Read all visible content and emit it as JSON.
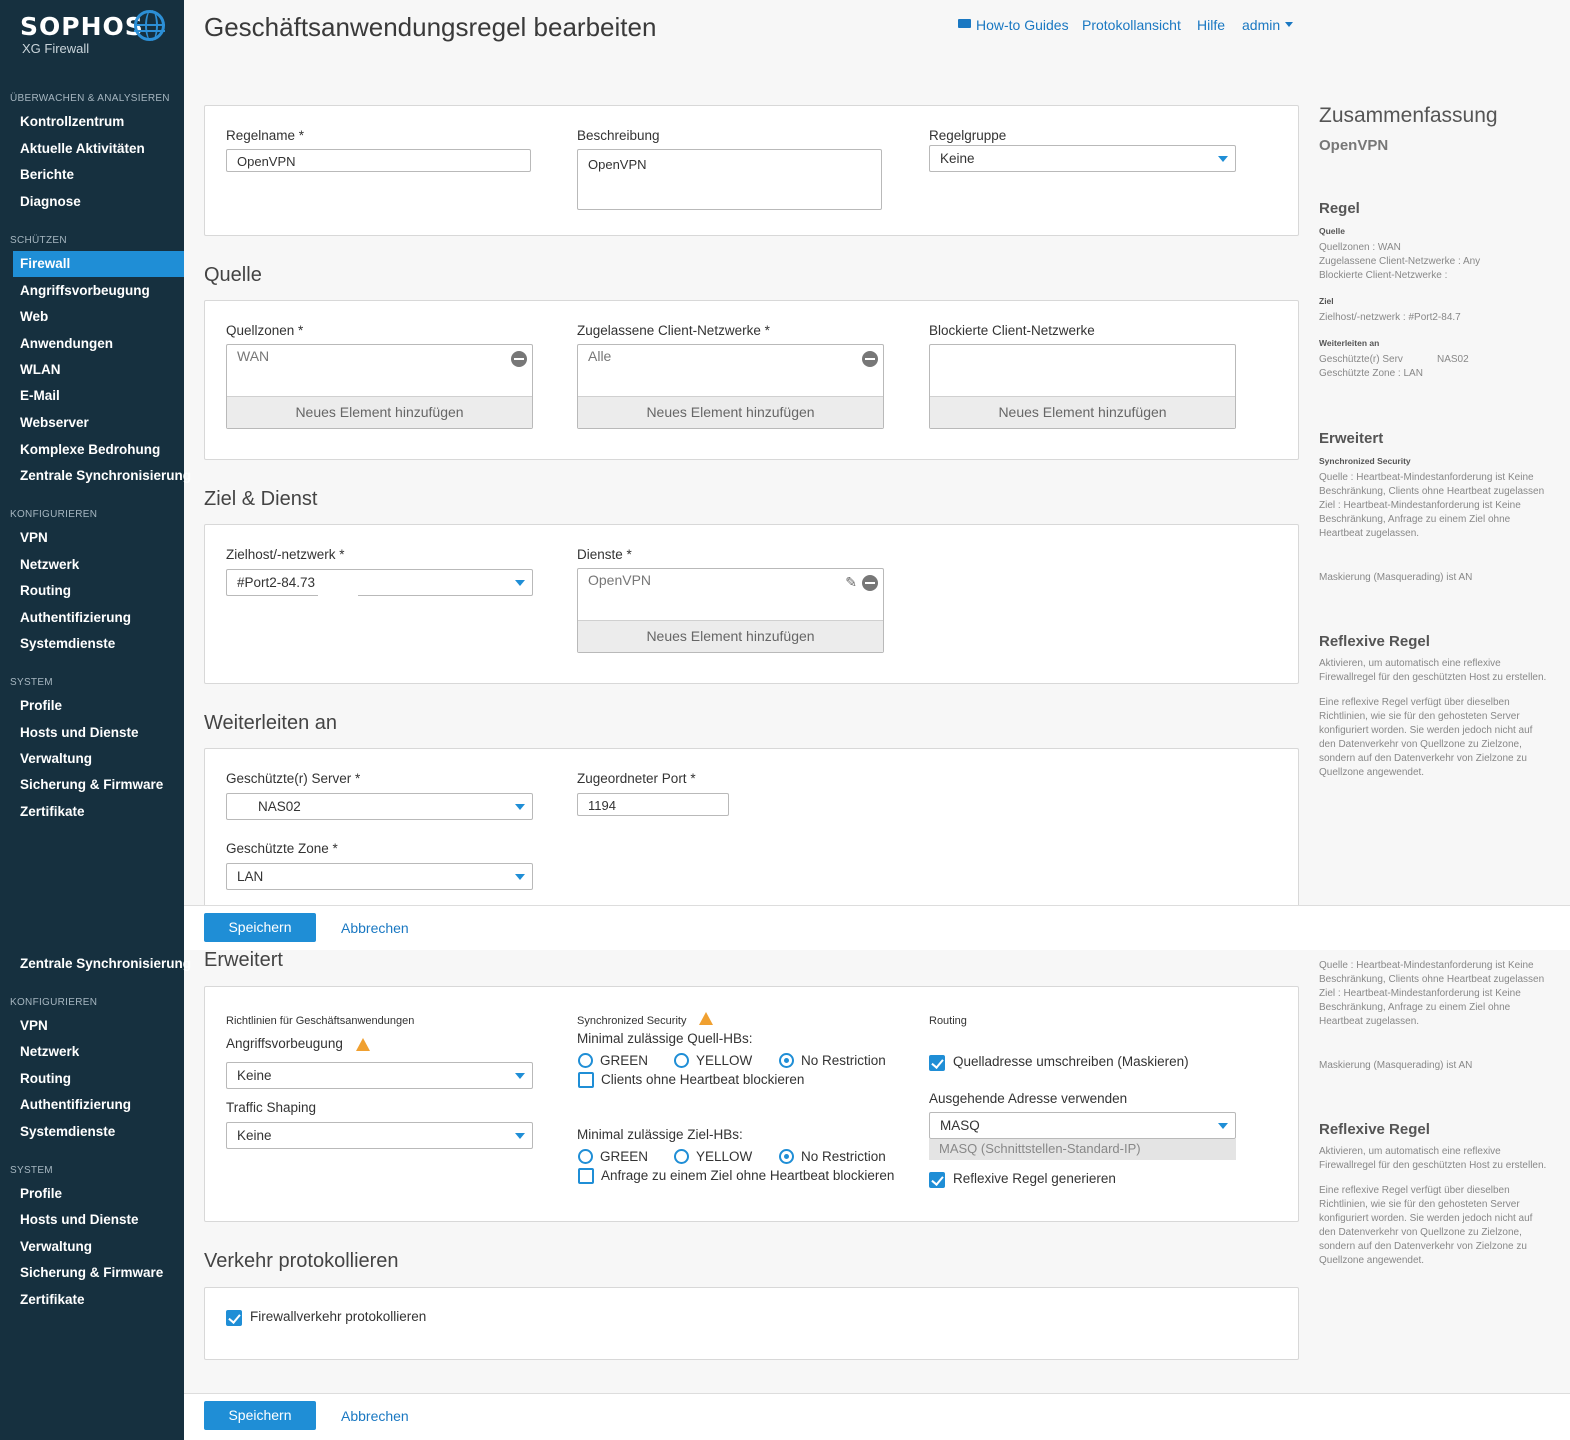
{
  "brand": {
    "name": "SOPHOS",
    "product": "XG Firewall"
  },
  "sidebar": {
    "sections": [
      {
        "title": "ÜBERWACHEN & ANALYSIEREN",
        "items": [
          "Kontrollzentrum",
          "Aktuelle Aktivitäten",
          "Berichte",
          "Diagnose"
        ]
      },
      {
        "title": "SCHÜTZEN",
        "items": [
          "Firewall",
          "Angriffsvorbeugung",
          "Web",
          "Anwendungen",
          "WLAN",
          "E-Mail",
          "Webserver",
          "Komplexe Bedrohung",
          "Zentrale Synchronisierung"
        ]
      },
      {
        "title": "KONFIGURIEREN",
        "items": [
          "VPN",
          "Netzwerk",
          "Routing",
          "Authentifizierung",
          "Systemdienste"
        ]
      },
      {
        "title": "SYSTEM",
        "items": [
          "Profile",
          "Hosts und Dienste",
          "Verwaltung",
          "Sicherung & Firmware",
          "Zertifikate"
        ]
      }
    ],
    "active": "Firewall"
  },
  "header": {
    "title": "Geschäftsanwendungsregel bearbeiten",
    "links": {
      "guides": "How-to Guides",
      "log": "Protokollansicht",
      "help": "Hilfe",
      "user": "admin"
    }
  },
  "general": {
    "rule_name_label": "Regelname *",
    "rule_name": "OpenVPN",
    "description_label": "Beschreibung",
    "description": "OpenVPN",
    "group_label": "Regelgruppe",
    "group": "Keine"
  },
  "source": {
    "title": "Quelle",
    "zones_label": "Quellzonen *",
    "zones": "WAN",
    "allowed_label": "Zugelassene Client-Netzwerke *",
    "allowed": "Alle",
    "blocked_label": "Blockierte Client-Netzwerke",
    "add_label": "Neues Element hinzufügen"
  },
  "destination": {
    "title": "Ziel & Dienst",
    "host_label": "Zielhost/-netzwerk *",
    "host": "#Port2-84.73",
    "services_label": "Dienste *",
    "services": "OpenVPN",
    "add_label": "Neues Element hinzufügen"
  },
  "forward": {
    "title": "Weiterleiten an",
    "server_label": "Geschützte(r) Server *",
    "server": "NAS02",
    "port_label": "Zugeordneter Port *",
    "port": "1194",
    "zone_label": "Geschützte Zone *",
    "zone": "LAN"
  },
  "actions": {
    "save": "Speichern",
    "cancel": "Abbrechen"
  },
  "advanced": {
    "title": "Erweitert",
    "policies_label": "Richtlinien für Geschäftsanwendungen",
    "ips_label": "Angriffsvorbeugung",
    "ips": "Keine",
    "shaping_label": "Traffic Shaping",
    "shaping": "Keine",
    "sync_label": "Synchronized Security",
    "min_src_label": "Minimal zulässige Quell-HBs:",
    "min_dst_label": "Minimal zulässige Ziel-HBs:",
    "green": "GREEN",
    "yellow": "YELLOW",
    "norestr": "No Restriction",
    "block_src": "Clients ohne Heartbeat blockieren",
    "block_dst": "Anfrage zu einem Ziel ohne Heartbeat blockieren",
    "routing_label": "Routing",
    "masq_label": "Quelladresse umschreiben (Maskieren)",
    "outgoing_label": "Ausgehende Adresse verwenden",
    "outgoing": "MASQ",
    "outgoing_hint": "MASQ (Schnittstellen-Standard-IP)",
    "reflexive_label": "Reflexive Regel generieren"
  },
  "log": {
    "title": "Verkehr protokollieren",
    "fw_label": "Firewallverkehr protokollieren"
  },
  "summary": {
    "title": "Zusammenfassung",
    "name": "OpenVPN",
    "rule_h": "Regel",
    "source_h": "Quelle",
    "source_lines": [
      "Quellzonen : WAN",
      "Zugelassene Client-Netzwerke : Any",
      "Blockierte Client-Netzwerke :"
    ],
    "dest_h": "Ziel",
    "dest_line": "Zielhost/-netzwerk : #Port2-84.7",
    "fwd_h": "Weiterleiten an",
    "fwd_server_prefix": "Geschützte(r) Serv",
    "fwd_server_value": "NAS02",
    "fwd_zone": "Geschützte Zone : LAN",
    "adv_h": "Erweitert",
    "sync_h": "Synchronized Security",
    "sync_lines": [
      "Quelle : Heartbeat-Mindestanforderung ist Keine",
      "Beschränkung, Clients ohne Heartbeat zugelassen",
      "Ziel : Heartbeat-Mindestanforderung ist Keine",
      "Beschränkung, Anfrage zu einem Ziel ohne",
      "Heartbeat zugelassen."
    ],
    "masq_line": "Maskierung (Masquerading) ist AN",
    "refl_h": "Reflexive Regel",
    "refl_lines1": [
      "Aktivieren, um automatisch eine reflexive",
      "Firewallregel für den geschützten Host zu erstellen."
    ],
    "refl_lines2": [
      "Eine reflexive Regel verfügt über dieselben",
      "Richtlinien, wie sie für den gehosteten Server",
      "konfiguriert worden. Sie werden jedoch nicht auf",
      "den Datenverkehr von Quellzone zu Zielzone,",
      "sondern auf den Datenverkehr von Zielzone zu",
      "Quellzone angewendet."
    ]
  },
  "colors": {
    "sidebar": "#16303f",
    "accent": "#1f8ed6",
    "warning": "#f0a030"
  }
}
